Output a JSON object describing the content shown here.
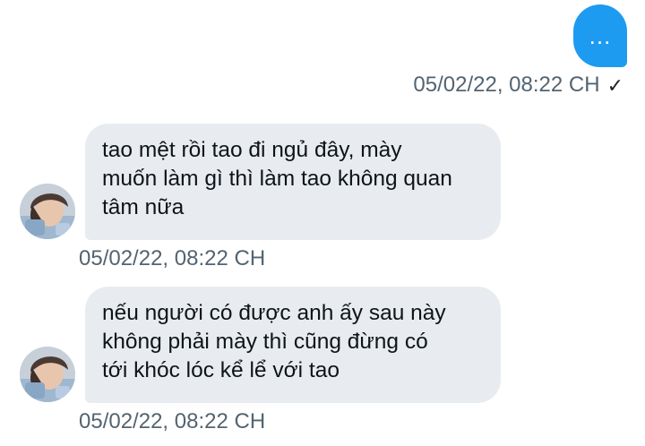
{
  "conversation": {
    "sent": {
      "text": "...",
      "timestamp": "05/02/22, 08:22 CH",
      "status_icon": "check-icon"
    },
    "received": [
      {
        "lines": [
          "tao mệt rồi tao đi ngủ đây, mày",
          "muốn làm gì thì làm tao không quan",
          "tâm nữa"
        ],
        "timestamp": "05/02/22, 08:22 CH",
        "avatar_icon": "avatar"
      },
      {
        "lines": [
          "nếu người có được anh ấy sau này",
          "không phải mày thì cũng đừng có",
          "tới khóc lóc kể lể với tao"
        ],
        "timestamp": "05/02/22, 08:22 CH",
        "avatar_icon": "avatar"
      }
    ]
  },
  "colors": {
    "sent_bubble": "#1d9bf0",
    "received_bubble": "#e8ecf0",
    "timestamp_text": "#536471",
    "message_text": "#0f1419"
  }
}
